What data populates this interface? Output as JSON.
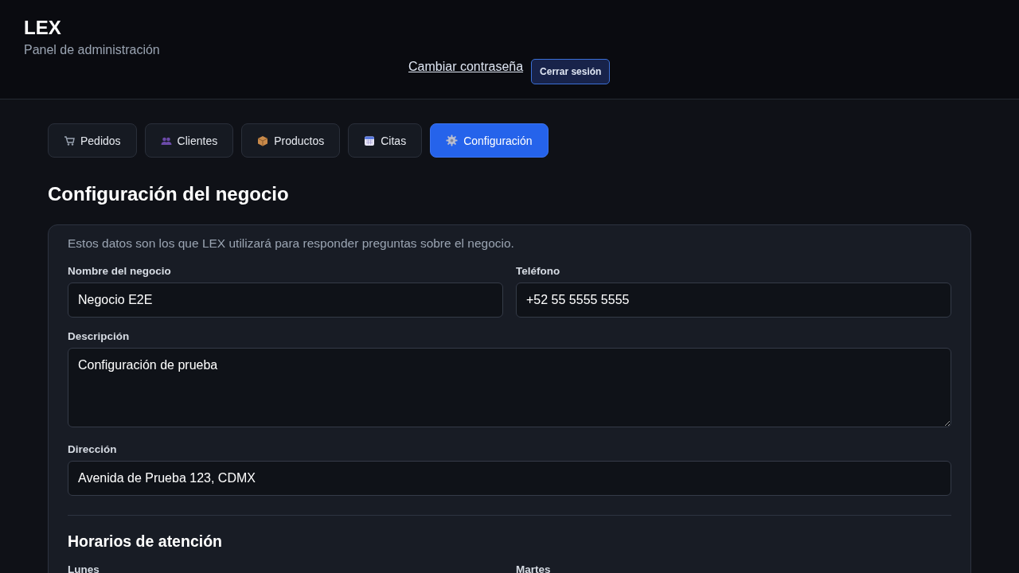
{
  "header": {
    "title": "LEX",
    "subtitle": "Panel de administración",
    "link": "Cambiar contraseña",
    "logout": "Cerrar sesión"
  },
  "tabs": [
    {
      "label": "Pedidos",
      "selected": false
    },
    {
      "label": "Clientes",
      "selected": false
    },
    {
      "label": "Productos",
      "selected": false
    },
    {
      "label": "Citas",
      "selected": false
    },
    {
      "label": "Configuración",
      "selected": true
    }
  ],
  "page_title": "Configuración del negocio",
  "form": {
    "intro": "Estos datos son los que LEX utilizará para responder preguntas sobre el negocio.",
    "fields": [
      {
        "kind": "input",
        "label": "Nombre del negocio",
        "value": "Negocio E2E"
      },
      {
        "kind": "input",
        "label": "Teléfono",
        "value": "+52 55 5555 5555"
      },
      {
        "kind": "textarea",
        "label": "Descripción",
        "value": "Configuración de prueba"
      },
      {
        "kind": "input",
        "label": "Dirección",
        "value": "Avenida de Prueba 123, CDMX"
      }
    ],
    "hours_title": "Horarios de atención",
    "days": [
      {
        "label": "Lunes"
      },
      {
        "label": "Martes"
      }
    ]
  }
}
